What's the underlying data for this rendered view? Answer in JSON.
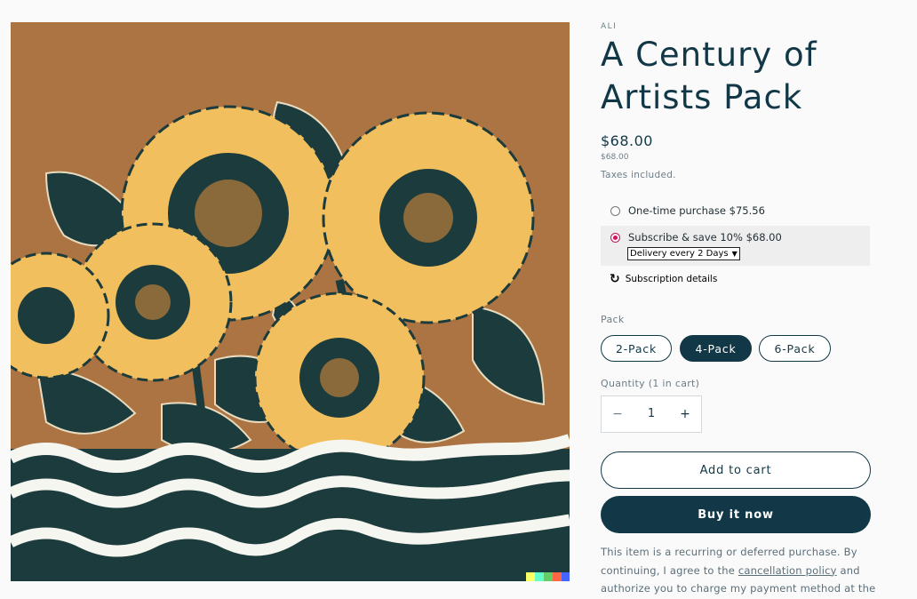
{
  "product": {
    "vendor": "ALI",
    "title_line1": "A Century of",
    "title_line2": "Artists Pack",
    "price": "$68.00",
    "price_small": "$68.00",
    "taxes": "Taxes included."
  },
  "subscription": {
    "one_time_label": "One-time purchase $75.56",
    "subscribe_label": "Subscribe & save 10% $68.00",
    "delivery_selected": "Delivery every 2 Days",
    "details_label": "Subscription details",
    "selected": "subscribe"
  },
  "pack": {
    "label": "Pack",
    "options": [
      "2-Pack",
      "4-Pack",
      "6-Pack"
    ],
    "selected": "4-Pack"
  },
  "quantity": {
    "label": "Quantity (1 in cart)",
    "minus": "−",
    "value": "1",
    "plus": "+"
  },
  "buttons": {
    "add_to_cart": "Add to cart",
    "buy_now": "Buy it now"
  },
  "note": {
    "before_link": "This item is a recurring or deferred purchase. By continuing, I agree to the ",
    "link": "cancellation policy",
    "after_link": " and authorize you to charge my payment method at the"
  },
  "colors": {
    "brand": "#123847",
    "radio_accent": "#d8125e",
    "muted": "#6b7e87"
  },
  "icons": {
    "refresh": "refresh-icon"
  }
}
